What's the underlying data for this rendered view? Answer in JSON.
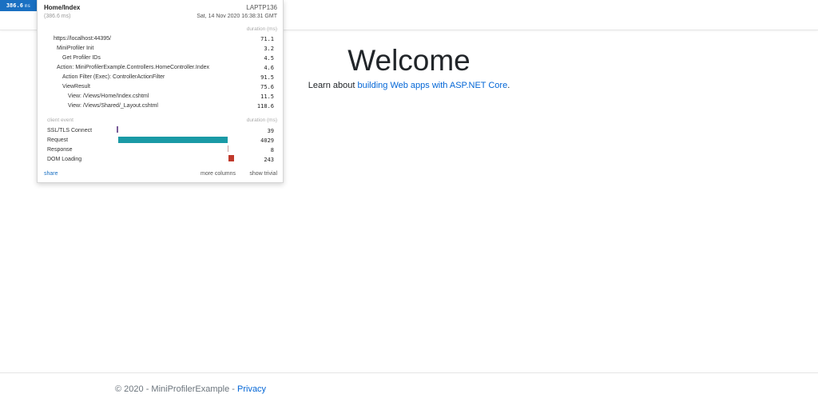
{
  "profiler": {
    "badge_value": "386.6",
    "badge_unit": "ms",
    "title": "Home/Index",
    "machine": "LAPTP136",
    "duration": "(386.6 ms)",
    "date": "Sat, 14 Nov 2020 16:38:31 GMT",
    "timings_header": "duration (ms)",
    "timings": [
      {
        "label": "https://localhost:44395/",
        "value": "71.1"
      },
      {
        "label": "MiniProfiler Init",
        "value": "3.2"
      },
      {
        "label": "Get Profiler IDs",
        "value": "4.5"
      },
      {
        "label": "Action: MiniProfilerExample.Controllers.HomeController.Index",
        "value": "4.6"
      },
      {
        "label": "Action Filter (Exec): ControllerActionFilter",
        "value": "91.5"
      },
      {
        "label": "ViewResult",
        "value": "75.6"
      },
      {
        "label": "View: /Views/Home/Index.cshtml",
        "value": "11.5"
      },
      {
        "label": "View: /Views/Shared/_Layout.cshtml",
        "value": "118.6"
      }
    ],
    "client_header_left": "client event",
    "client_header_right": "duration (ms)",
    "client_events": [
      {
        "label": "SSL/TLS Connect",
        "value": "39",
        "color": "#7a5c99"
      },
      {
        "label": "Request",
        "value": "4029",
        "color": "#1a9aa6"
      },
      {
        "label": "Response",
        "value": "8",
        "color": "#c9a0a0"
      },
      {
        "label": "DOM Loading",
        "value": "243",
        "color": "#c0392b"
      }
    ],
    "share_label": "share",
    "more_columns_label": "more columns",
    "show_trivial_label": "show trivial"
  },
  "main": {
    "heading": "Welcome",
    "learn_prefix": "Learn about ",
    "learn_link": "building Web apps with ASP.NET Core",
    "learn_suffix": "."
  },
  "footer": {
    "copyright": "© 2020 - MiniProfilerExample - ",
    "privacy_link": "Privacy"
  }
}
